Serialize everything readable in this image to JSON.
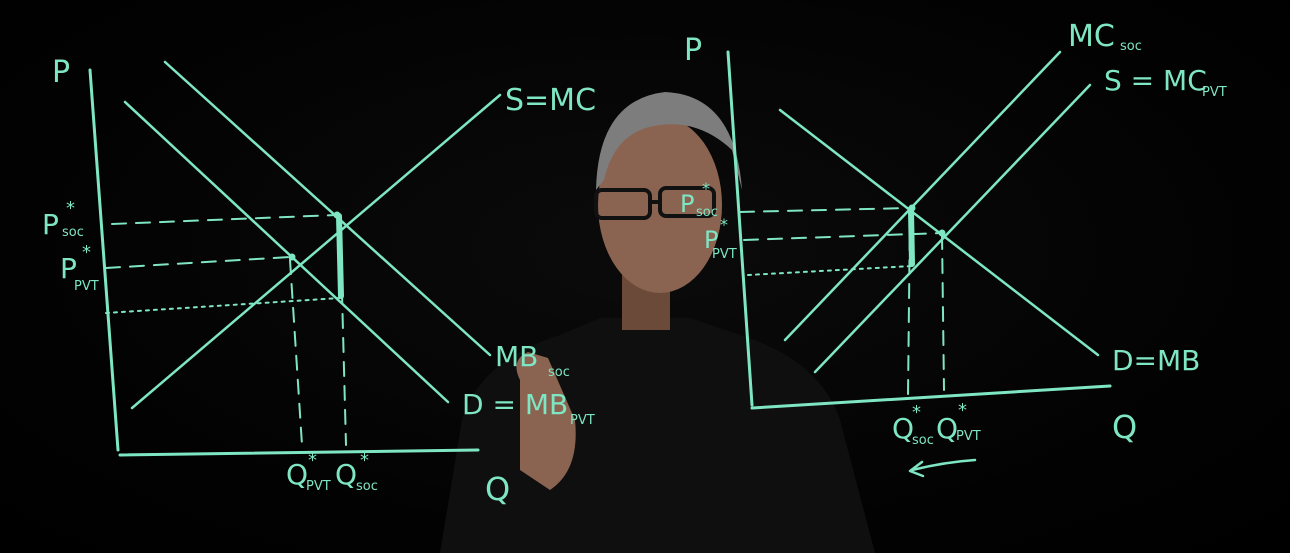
{
  "colors": {
    "ink": "#7fe6c4",
    "background": "#000000"
  },
  "left_graph": {
    "axis_p": "P",
    "axis_q": "Q",
    "supply_label": "S=MC",
    "mb_soc_label": "MB",
    "mb_soc_sub": "soc",
    "demand_label": "D = MB",
    "demand_sub": "PVT",
    "p_soc": "P",
    "p_soc_sub": "soc",
    "p_pvt": "P",
    "p_pvt_sub": "PVT",
    "q_pvt": "Q",
    "q_pvt_sub": "PVT",
    "q_soc": "Q",
    "q_soc_sub": "soc",
    "star": "*"
  },
  "right_graph": {
    "axis_p": "P",
    "axis_q": "Q",
    "mc_soc_label": "MC",
    "mc_soc_sub": "soc",
    "supply_label": "S = MC",
    "supply_sub": "PVT",
    "demand_label": "D=MB",
    "p_soc": "P",
    "p_soc_sub": "soc",
    "p_pvt": "P",
    "p_pvt_sub": "PVT",
    "q_soc": "Q",
    "q_soc_sub": "soc",
    "q_pvt": "Q",
    "q_pvt_sub": "PVT",
    "star": "*"
  }
}
